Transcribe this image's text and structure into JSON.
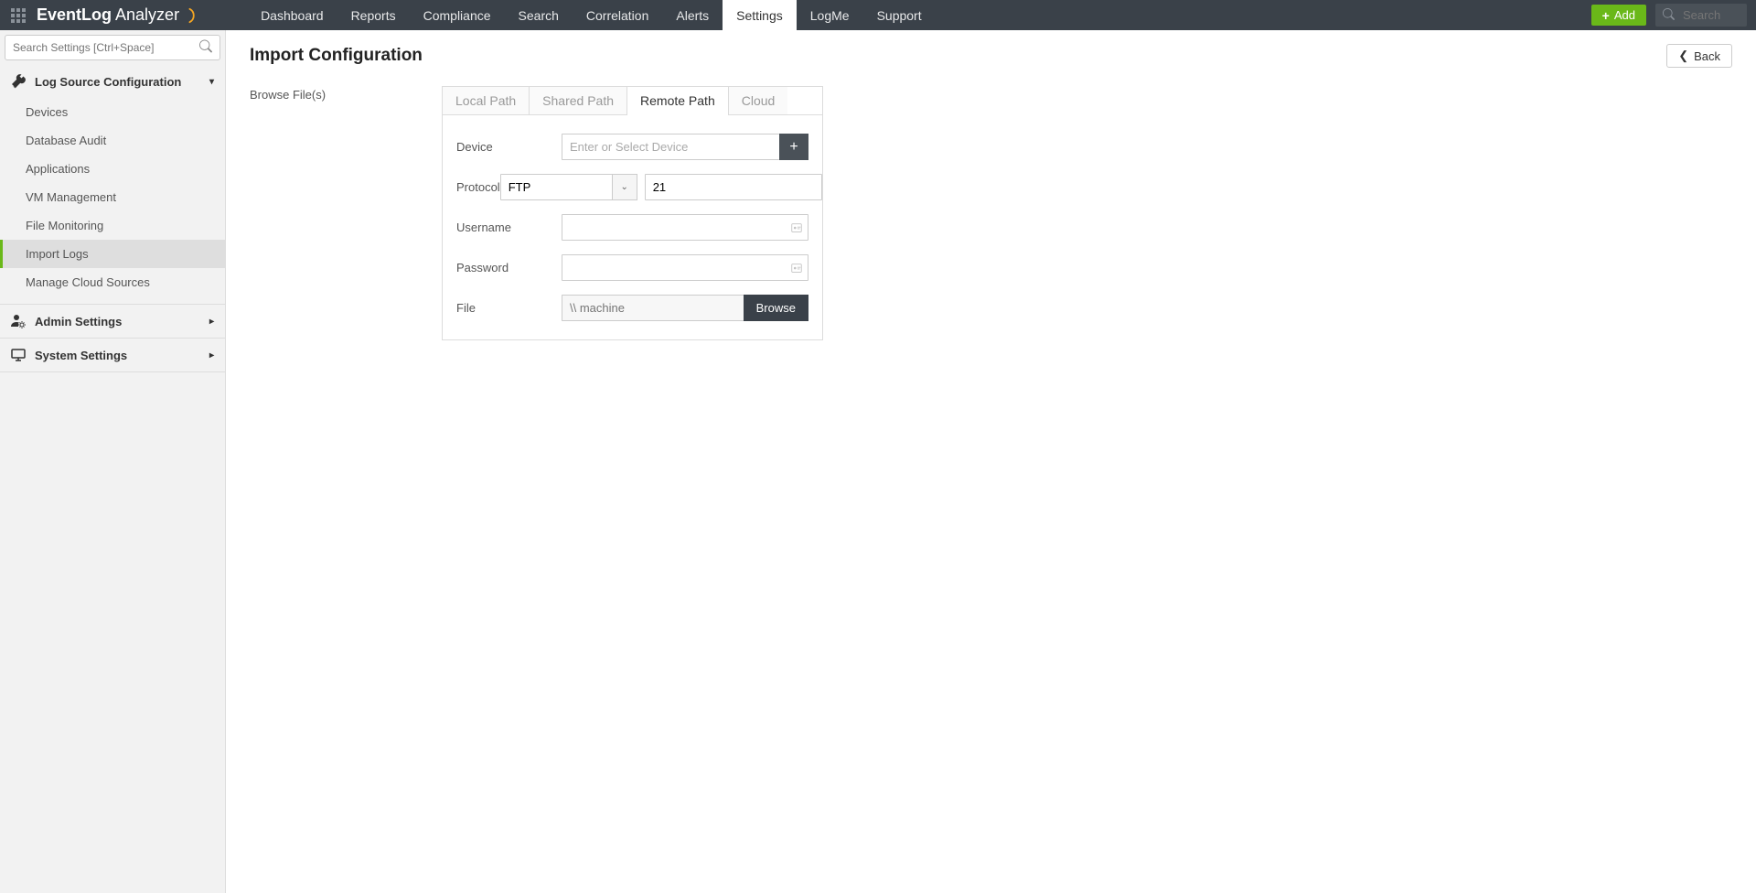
{
  "app_name_prefix": "EventLog",
  "app_name_suffix": "Analyzer",
  "top_nav": {
    "items": [
      "Dashboard",
      "Reports",
      "Compliance",
      "Search",
      "Correlation",
      "Alerts",
      "Settings",
      "LogMe",
      "Support"
    ],
    "active_index": 6,
    "add_label": "Add",
    "search_placeholder": "Search"
  },
  "sidebar": {
    "search_placeholder": "Search Settings [Ctrl+Space]",
    "sections": [
      {
        "label": "Log Source Configuration",
        "expanded": true,
        "items": [
          "Devices",
          "Database Audit",
          "Applications",
          "VM Management",
          "File Monitoring",
          "Import Logs",
          "Manage Cloud Sources"
        ],
        "active_item": "Import Logs"
      },
      {
        "label": "Admin Settings",
        "expanded": false
      },
      {
        "label": "System Settings",
        "expanded": false
      }
    ]
  },
  "page": {
    "title": "Import Configuration",
    "back_label": "Back",
    "left_label": "Browse File(s)"
  },
  "tabs": {
    "items": [
      "Local Path",
      "Shared Path",
      "Remote Path",
      "Cloud"
    ],
    "active_index": 2
  },
  "form": {
    "device": {
      "label": "Device",
      "placeholder": "Enter or Select Device",
      "value": ""
    },
    "protocol": {
      "label": "Protocol",
      "value": "FTP",
      "port": "21"
    },
    "username": {
      "label": "Username",
      "value": ""
    },
    "password": {
      "label": "Password",
      "value": ""
    },
    "file": {
      "label": "File",
      "placeholder": "\\\\ machine",
      "value": "",
      "browse_label": "Browse"
    }
  }
}
